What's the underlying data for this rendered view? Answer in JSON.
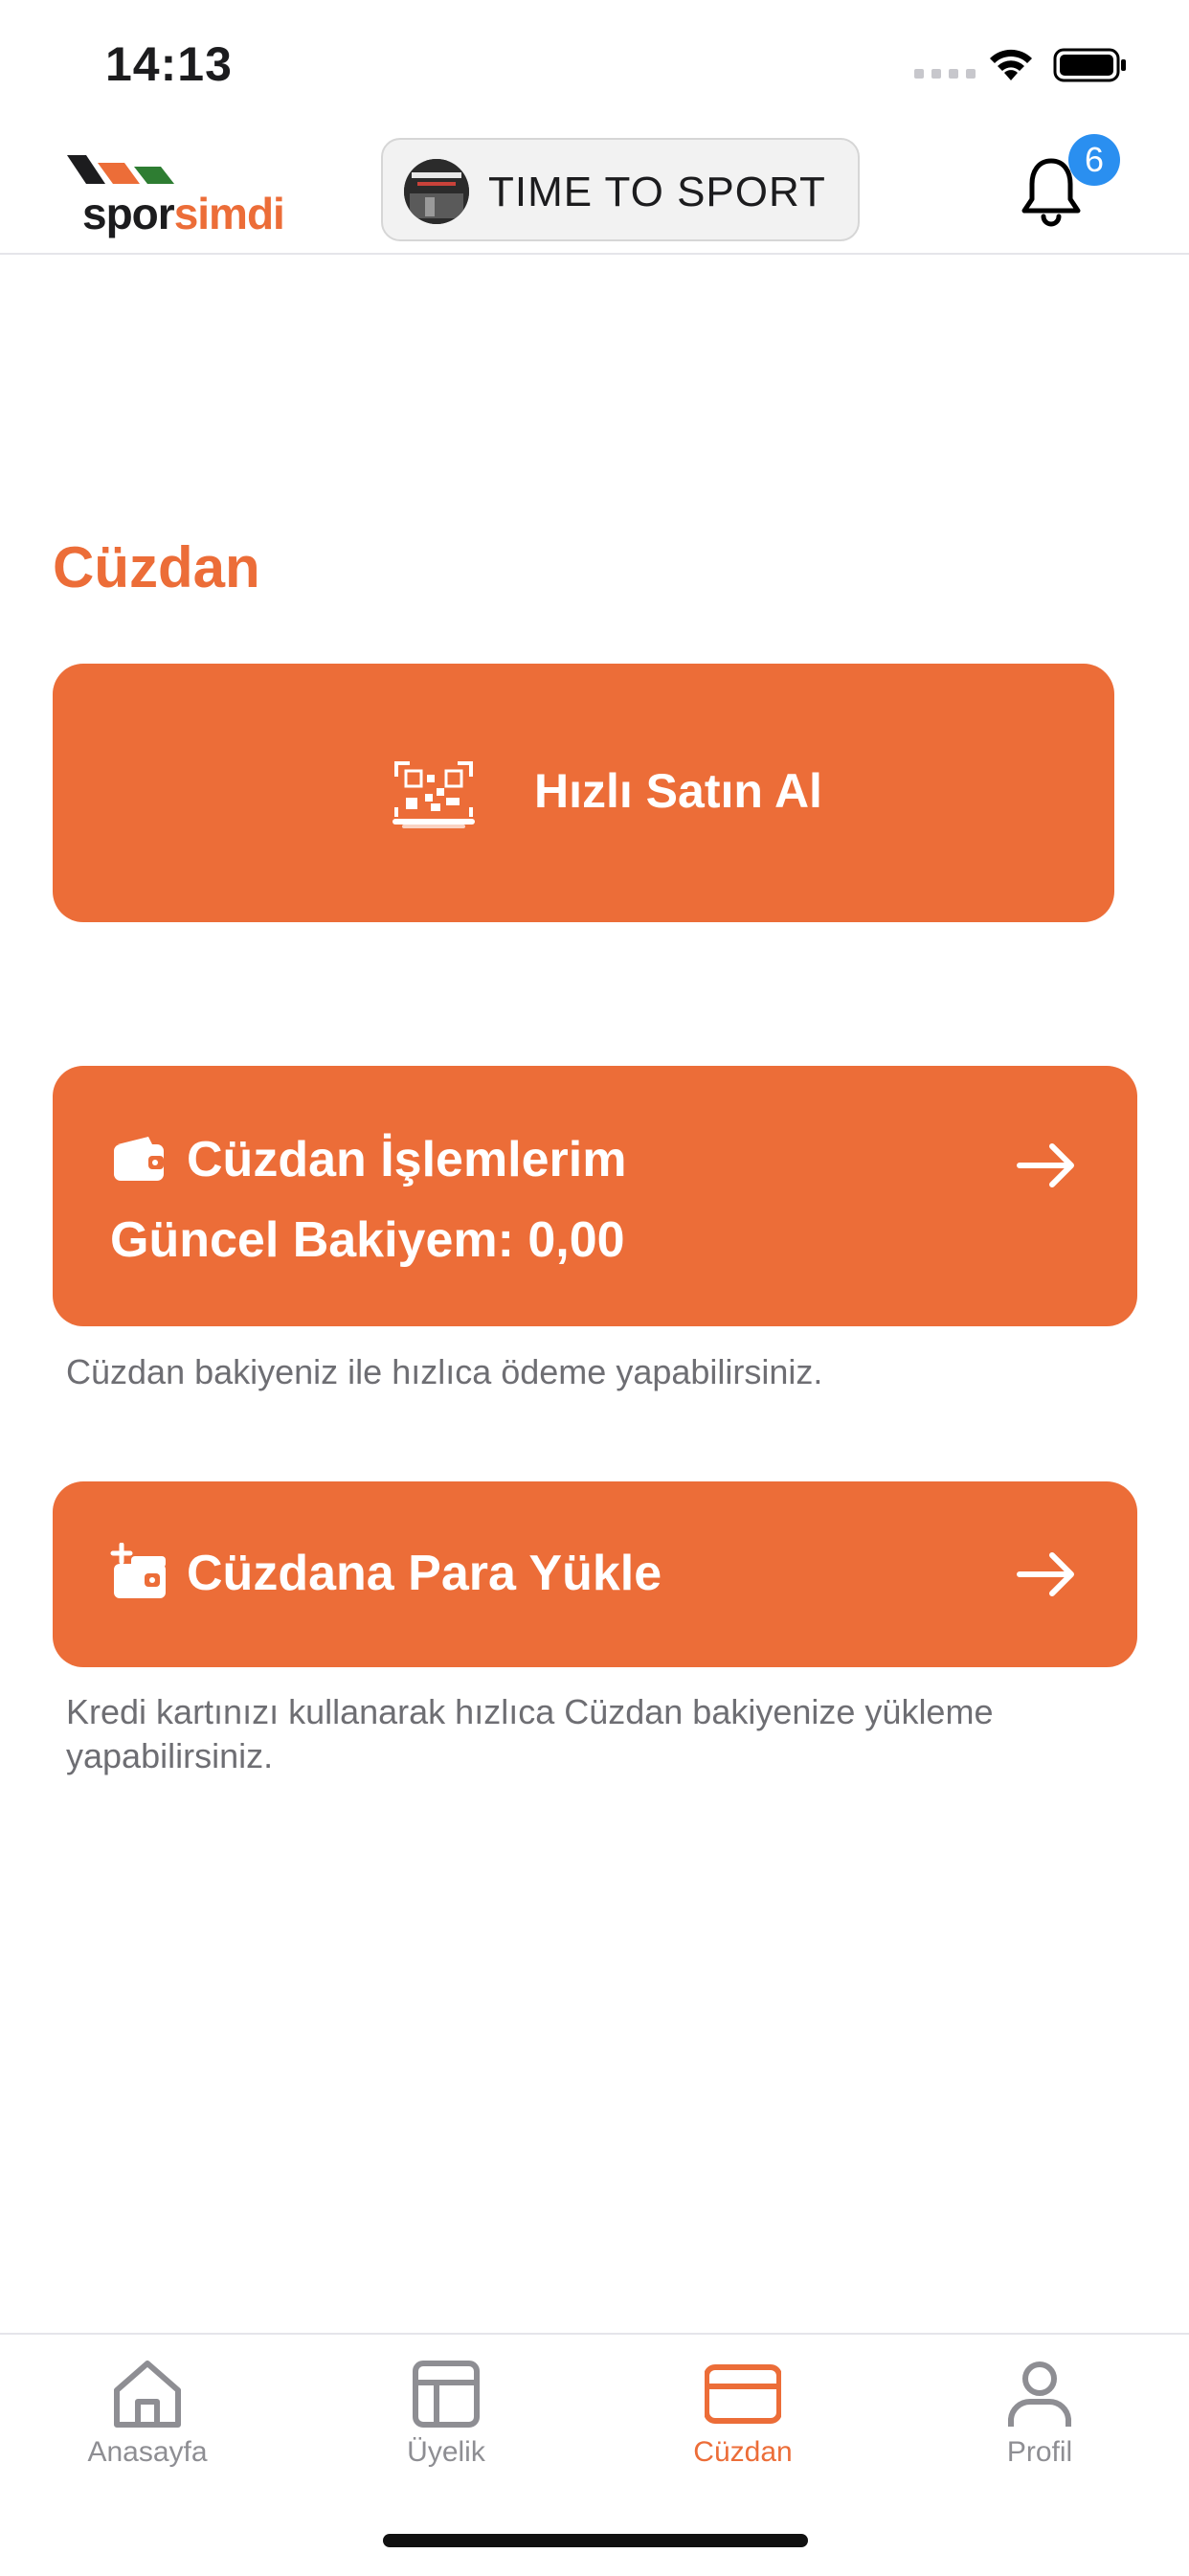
{
  "status_bar": {
    "time": "14:13"
  },
  "header": {
    "logo": {
      "part1": "spor",
      "part2": "simdi"
    },
    "gym_selector": {
      "name": "TIME TO SPORT"
    },
    "notifications": {
      "count": "6"
    }
  },
  "page": {
    "title": "Cüzdan",
    "quick_buy": {
      "label": "Hızlı Satın Al"
    },
    "wallet_transactions": {
      "title": "Cüzdan İşlemlerim",
      "balance": "Güncel Bakiyem: 0,00",
      "help": "Cüzdan bakiyeniz ile hızlıca ödeme yapabilirsiniz."
    },
    "top_up": {
      "title": "Cüzdana Para Yükle",
      "help": "Kredi kartınızı kullanarak hızlıca Cüzdan bakiyenize yükleme yapabilirsiniz."
    }
  },
  "tab_bar": {
    "items": [
      {
        "label": "Anasayfa",
        "icon": "home-icon",
        "active": false
      },
      {
        "label": "Üyelik",
        "icon": "layout-icon",
        "active": false
      },
      {
        "label": "Cüzdan",
        "icon": "card-icon",
        "active": true
      },
      {
        "label": "Profil",
        "icon": "user-icon",
        "active": false
      }
    ]
  },
  "colors": {
    "accent": "#ec6d38",
    "badge": "#2a8ff0",
    "muted": "#8e8e93"
  }
}
